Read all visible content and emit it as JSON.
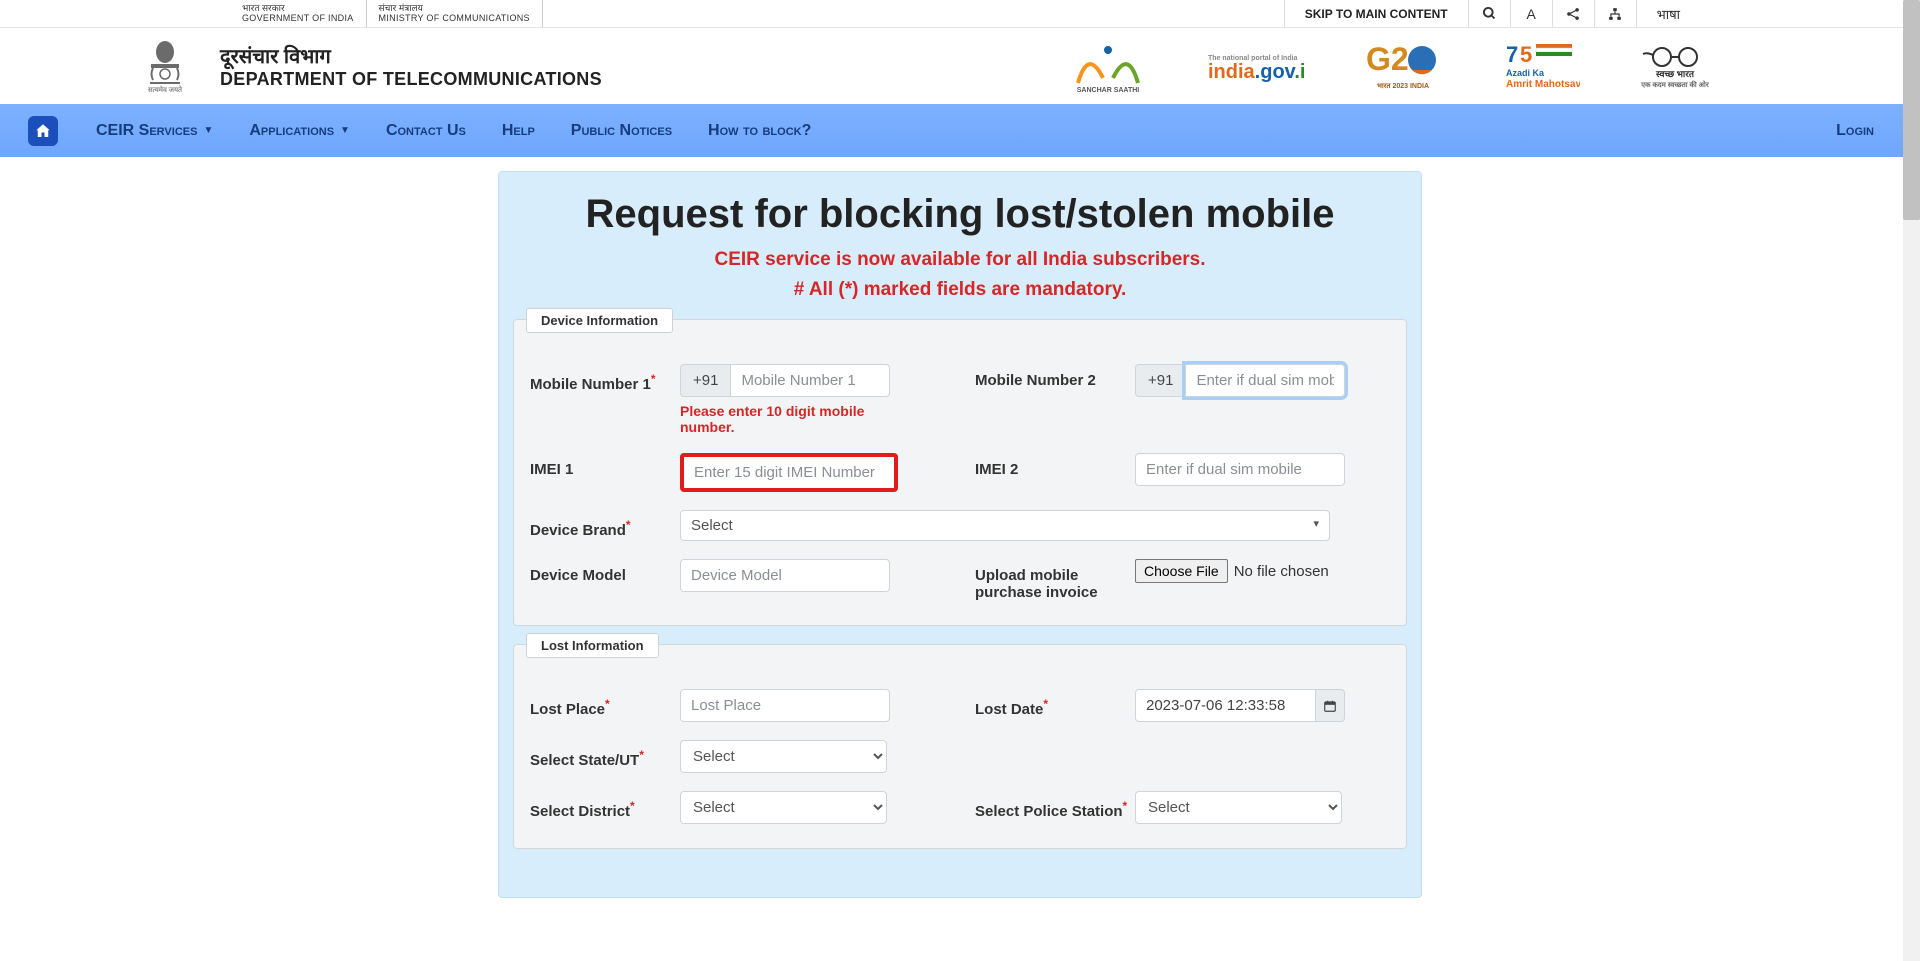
{
  "topbar": {
    "gov1_hindi": "भारत सरकार",
    "gov1_eng": "GOVERNMENT OF INDIA",
    "gov2_hindi": "संचार मंत्रालय",
    "gov2_eng": "MINISTRY OF COMMUNICATIONS",
    "skip": "SKIP TO MAIN CONTENT",
    "lang": "भाषा"
  },
  "header": {
    "dept_hindi": "दूरसंचार विभाग",
    "dept_eng": "DEPARTMENT OF TELECOMMUNICATIONS",
    "emblem_caption": "सत्यमेव जयते"
  },
  "logos": {
    "sanchar": "SANCHAR SAATHI",
    "indiagov": "india.gov.in",
    "g20": "G20",
    "azadi": "Azadi Ka Amrit Mahotsav",
    "swachh": "स्वच्छ भारत"
  },
  "nav": {
    "ceir": "CEIR Services",
    "apps": "Applications",
    "contact": "Contact Us",
    "help": "Help",
    "notices": "Public Notices",
    "howto": "How to block?",
    "login": "Login"
  },
  "page": {
    "title": "Request for blocking lost/stolen mobile",
    "sub1": "CEIR service is now available for all India subscribers.",
    "sub2": "# All (*) marked fields are mandatory."
  },
  "section1": {
    "legend": "Device Information",
    "mob1_label": "Mobile Number 1",
    "mob2_label": "Mobile Number 2",
    "prefix": "+91",
    "mob1_placeholder": "Mobile Number 1",
    "mob2_placeholder": "Enter if dual sim mobile",
    "mob1_error": "Please enter 10 digit mobile number.",
    "imei1_label": "IMEI 1",
    "imei2_label": "IMEI 2",
    "imei1_placeholder": "Enter 15 digit IMEI Number",
    "imei2_placeholder": "Enter if dual sim mobile",
    "brand_label": "Device Brand",
    "brand_select": "Select",
    "model_label": "Device Model",
    "model_placeholder": "Device Model",
    "upload_label": "Upload mobile purchase invoice",
    "file_btn": "Choose File",
    "file_txt": "No file chosen"
  },
  "section2": {
    "legend": "Lost Information",
    "place_label": "Lost Place",
    "place_placeholder": "Lost Place",
    "date_label": "Lost Date",
    "date_value": "2023-07-06 12:33:58",
    "state_label": "Select State/UT",
    "state_select": "Select",
    "district_label": "Select District",
    "district_select": "Select",
    "police_label": "Select Police Station",
    "police_select": "Select"
  }
}
